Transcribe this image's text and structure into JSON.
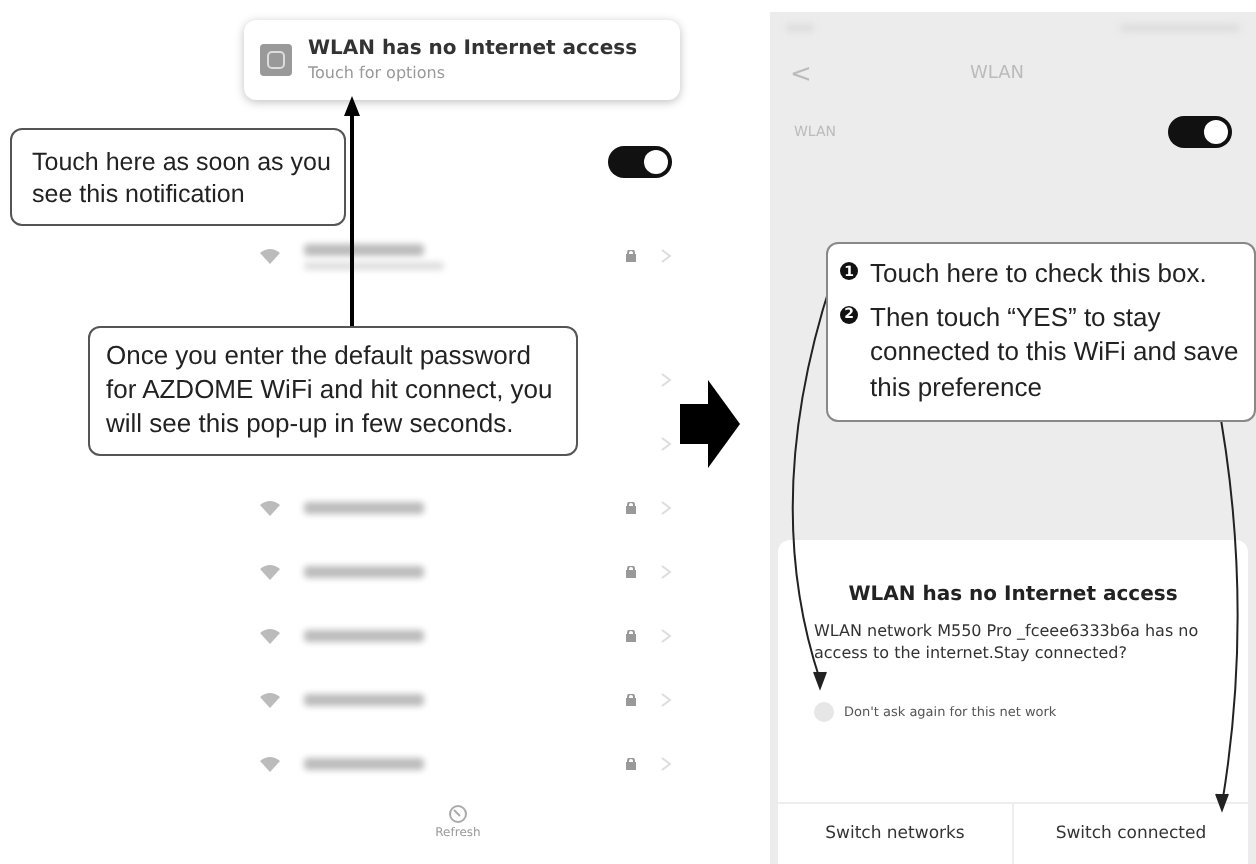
{
  "left_screen": {
    "notification": {
      "title": "WLAN has no Internet access",
      "subtitle": "Touch for options"
    },
    "wlan_toggle": {
      "on": true
    },
    "networks": [
      {
        "kind": "detailed",
        "locked": true
      },
      {
        "kind": "covered",
        "locked": false
      },
      {
        "kind": "covered",
        "locked": false
      },
      {
        "kind": "plain",
        "locked": true
      },
      {
        "kind": "plain",
        "locked": true
      },
      {
        "kind": "plain",
        "locked": true
      },
      {
        "kind": "plain",
        "locked": true
      },
      {
        "kind": "plain",
        "locked": true
      }
    ],
    "refresh": "Refresh"
  },
  "right_screen": {
    "header": {
      "back": "<",
      "title": "WLAN"
    },
    "wlan_label": "WLAN",
    "wlan_toggle": {
      "on": true
    },
    "dialog": {
      "title": "WLAN has no Internet access",
      "message": "WLAN network M550 Pro _fceee6333b6a has no access to the internet.Stay connected?",
      "checkbox": {
        "label": "Don't ask again for this net work",
        "checked": false
      },
      "buttons": [
        "Switch networks",
        "Switch connected"
      ]
    }
  },
  "callouts": [
    {
      "text": "Touch here as soon as you see this notification"
    },
    {
      "text": "Once you enter the default password for AZDOME WiFi and hit connect, you will see this pop-up in few seconds."
    }
  ],
  "steps_callout": {
    "steps": [
      {
        "number": "1",
        "text": "Touch here to check this box."
      },
      {
        "number": "2",
        "text": "Then touch “YES” to stay connected to this WiFi and save this preference"
      }
    ]
  }
}
